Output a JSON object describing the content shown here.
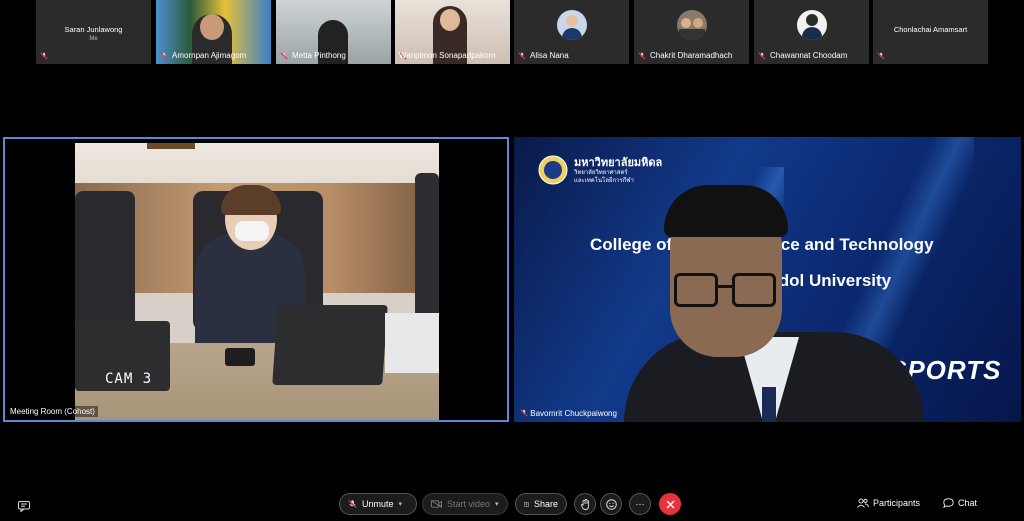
{
  "participants": [
    {
      "name": "Saran Junlawong",
      "sub": "Me"
    },
    {
      "name": "Amornpan Ajimagom"
    },
    {
      "name": "Metta Pinthong"
    },
    {
      "name": "Wanpimon Sonapadpakorn"
    },
    {
      "name": "Alisa Nana"
    },
    {
      "name": "Chakrit Dharamadhach"
    },
    {
      "name": "Chawannat Choodam"
    },
    {
      "name": "Chonlachai Amamsart"
    }
  ],
  "main": {
    "left_label": "Meeting Room (Cohost)",
    "cam_label": "CAM 3",
    "right_label": "Bavornrit Chuckpaiwong",
    "banner_thai": "มหาวิทยาลัยมหิดล",
    "banner_sub1": "วิทยาลัยวิทยาศาสตร์",
    "banner_sub2": "และเทคโนโลยีการกีฬา",
    "banner_line1": "College of Sports Science and Technology",
    "banner_line2": "Mahidol University",
    "banner_sports": "SPORTS"
  },
  "toolbar": {
    "unmute": "Unmute",
    "start_video": "Start video",
    "share": "Share",
    "more": "···",
    "participants": "Participants",
    "chat": "Chat"
  },
  "colors": {
    "end_button": "#e8333b",
    "active_border": "#5b8bd6",
    "tile_bg": "#2b2b2b"
  }
}
